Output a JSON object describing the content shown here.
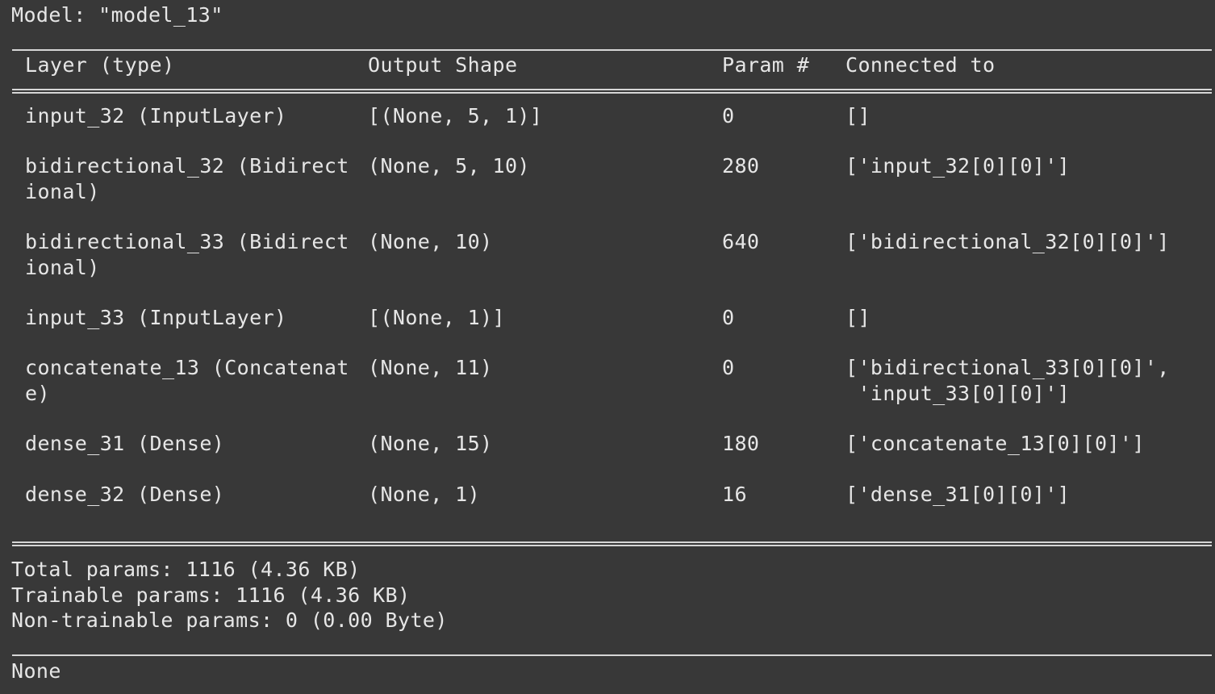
{
  "model_line": "Model: \"model_13\"",
  "headers": {
    "layer": "Layer (type)",
    "shape": "Output Shape",
    "param": "Param #",
    "conn": "Connected to"
  },
  "rows": [
    {
      "layer": "input_32 (InputLayer)",
      "shape": "[(None, 5, 1)]",
      "param": "0",
      "conn": "[]"
    },
    {
      "layer": "bidirectional_32 (Bidirect\nional)",
      "shape": "(None, 5, 10)",
      "param": "280",
      "conn": "['input_32[0][0]']"
    },
    {
      "layer": "bidirectional_33 (Bidirect\nional)",
      "shape": "(None, 10)",
      "param": "640",
      "conn": "['bidirectional_32[0][0]']"
    },
    {
      "layer": "input_33 (InputLayer)",
      "shape": "[(None, 1)]",
      "param": "0",
      "conn": "[]"
    },
    {
      "layer": "concatenate_13 (Concatenat\ne)",
      "shape": "(None, 11)",
      "param": "0",
      "conn": "['bidirectional_33[0][0]',\n 'input_33[0][0]']"
    },
    {
      "layer": "dense_31 (Dense)",
      "shape": "(None, 15)",
      "param": "180",
      "conn": "['concatenate_13[0][0]']"
    },
    {
      "layer": "dense_32 (Dense)",
      "shape": "(None, 1)",
      "param": "16",
      "conn": "['dense_31[0][0]']"
    }
  ],
  "totals": {
    "total": "Total params: 1116 (4.36 KB)",
    "trainable": "Trainable params: 1116 (4.36 KB)",
    "non_trainable": "Non-trainable params: 0 (0.00 Byte)"
  },
  "return_value": "None"
}
